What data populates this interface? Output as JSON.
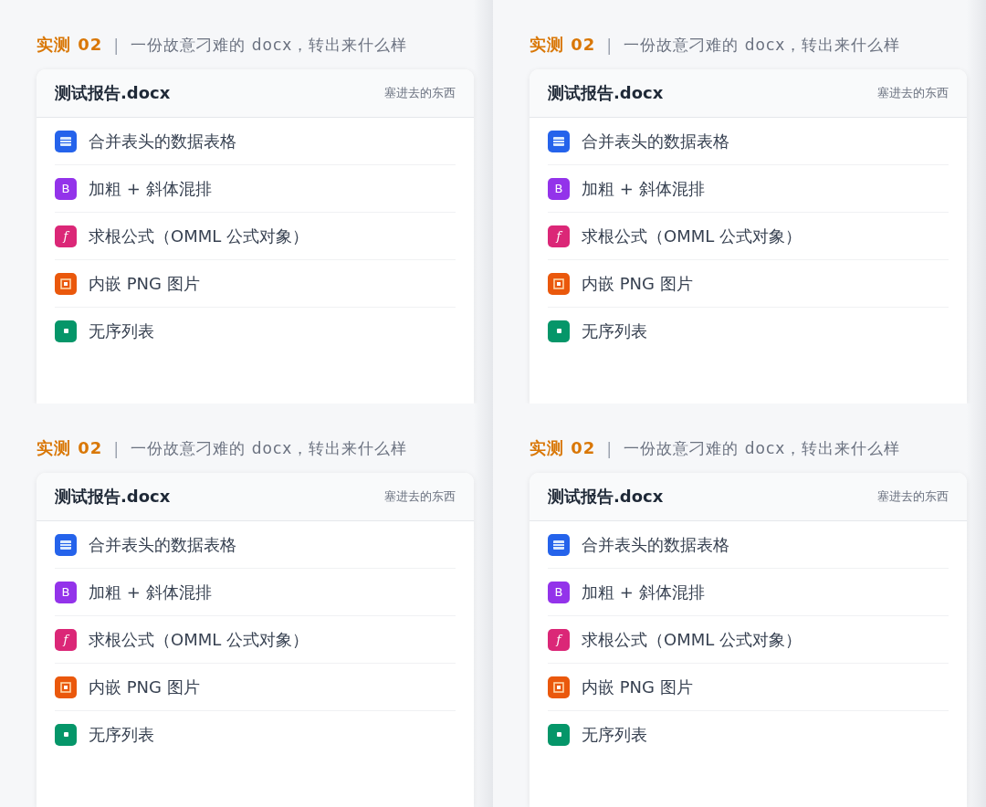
{
  "panels": [
    {
      "tag": "实测",
      "number": "02",
      "separator": "|",
      "subtitle": "一份故意刁难的 docx，转出来什么样",
      "card": {
        "title": "测试报告.docx",
        "note": "塞进去的东西",
        "items": [
          {
            "kind": "table",
            "color": "#2563eb",
            "label": "合并表头的数据表格"
          },
          {
            "kind": "bold",
            "color": "#9333ea",
            "glyph": "B",
            "label": "加粗 + 斜体混排"
          },
          {
            "kind": "formula",
            "color": "#db2777",
            "glyph": "f",
            "label": "求根公式（OMML 公式对象）"
          },
          {
            "kind": "image",
            "color": "#ea580c",
            "label": "内嵌 PNG 图片"
          },
          {
            "kind": "list",
            "color": "#059669",
            "label": "无序列表"
          }
        ]
      }
    },
    {
      "tag": "实测",
      "number": "02",
      "separator": "|",
      "subtitle": "一份故意刁难的 docx，转出来什么样",
      "card": {
        "title": "测试报告.docx",
        "note": "塞进去的东西",
        "items": [
          {
            "kind": "table",
            "color": "#2563eb",
            "label": "合并表头的数据表格"
          },
          {
            "kind": "bold",
            "color": "#9333ea",
            "glyph": "B",
            "label": "加粗 + 斜体混排"
          },
          {
            "kind": "formula",
            "color": "#db2777",
            "glyph": "f",
            "label": "求根公式（OMML 公式对象）"
          },
          {
            "kind": "image",
            "color": "#ea580c",
            "label": "内嵌 PNG 图片"
          },
          {
            "kind": "list",
            "color": "#059669",
            "label": "无序列表"
          }
        ]
      }
    },
    {
      "tag": "实测",
      "number": "02",
      "separator": "|",
      "subtitle": "一份故意刁难的 docx，转出来什么样",
      "card": {
        "title": "测试报告.docx",
        "note": "塞进去的东西",
        "items": [
          {
            "kind": "table",
            "color": "#2563eb",
            "label": "合并表头的数据表格"
          },
          {
            "kind": "bold",
            "color": "#9333ea",
            "glyph": "B",
            "label": "加粗 + 斜体混排"
          },
          {
            "kind": "formula",
            "color": "#db2777",
            "glyph": "f",
            "label": "求根公式（OMML 公式对象）"
          },
          {
            "kind": "image",
            "color": "#ea580c",
            "label": "内嵌 PNG 图片"
          },
          {
            "kind": "list",
            "color": "#059669",
            "label": "无序列表"
          }
        ]
      }
    },
    {
      "tag": "实测",
      "number": "02",
      "separator": "|",
      "subtitle": "一份故意刁难的 docx，转出来什么样",
      "card": {
        "title": "测试报告.docx",
        "note": "塞进去的东西",
        "items": [
          {
            "kind": "table",
            "color": "#2563eb",
            "label": "合并表头的数据表格"
          },
          {
            "kind": "bold",
            "color": "#9333ea",
            "glyph": "B",
            "label": "加粗 + 斜体混排"
          },
          {
            "kind": "formula",
            "color": "#db2777",
            "glyph": "f",
            "label": "求根公式（OMML 公式对象）"
          },
          {
            "kind": "image",
            "color": "#ea580c",
            "label": "内嵌 PNG 图片"
          },
          {
            "kind": "list",
            "color": "#059669",
            "label": "无序列表"
          }
        ]
      }
    }
  ]
}
